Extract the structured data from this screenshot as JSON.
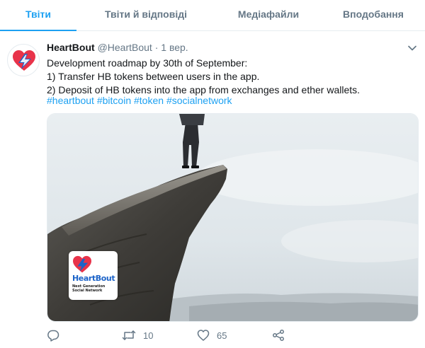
{
  "tabs": [
    {
      "label": "Твіти",
      "active": true
    },
    {
      "label": "Твіти й відповіді",
      "active": false
    },
    {
      "label": "Медіафайли",
      "active": false
    },
    {
      "label": "Вподобання",
      "active": false
    }
  ],
  "tweet": {
    "author_name": "HeartBout",
    "handle": "@HeartBout",
    "separator": "·",
    "time": "1 вер.",
    "text_lines": [
      "Development roadmap by 30th of September:",
      "1) Transfer HB tokens between users in the app.",
      "2) Deposit of HB tokens into the app from exchanges and ether wallets."
    ],
    "hashtags": [
      "#heartbout",
      "#bitcoin",
      "#token",
      "#socialnetwork"
    ],
    "media": {
      "logo_word": "HeartBout",
      "logo_sub_1": "Next Generation",
      "logo_sub_2": "Social Network"
    },
    "actions": {
      "reply_count": "",
      "retweet_count": "10",
      "like_count": "65"
    }
  },
  "icons": {
    "reply": "reply-icon",
    "retweet": "retweet-icon",
    "like": "heart-icon",
    "share": "share-icon",
    "menu": "chevron-down-icon"
  },
  "colors": {
    "accent": "#1da1f2",
    "secondary_text": "#657786",
    "brand_red": "#e8334a",
    "brand_blue": "#1c63c8"
  }
}
